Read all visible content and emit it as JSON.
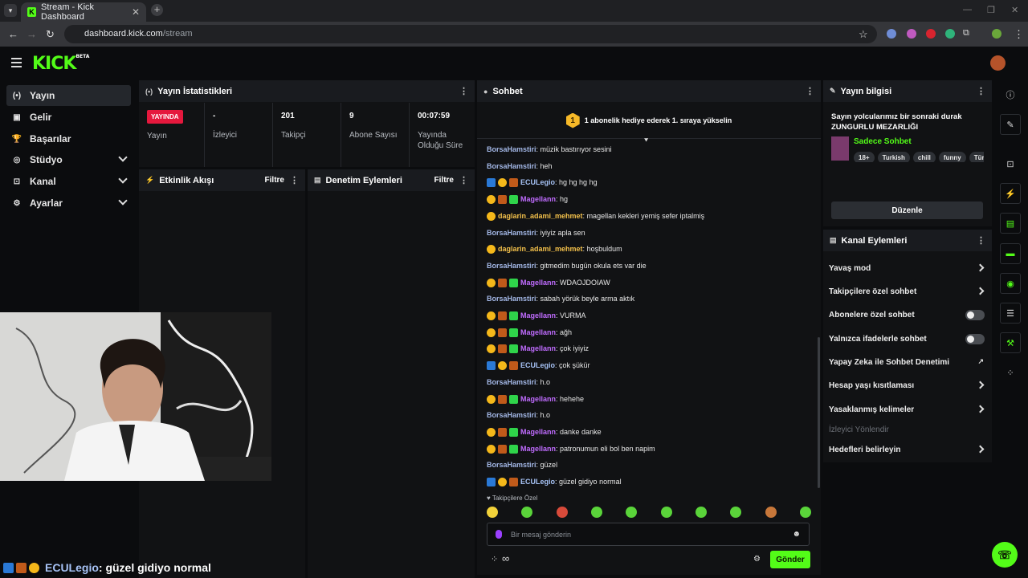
{
  "browser": {
    "tab_title": "Stream - Kick Dashboard",
    "tab_close": "✕",
    "new_tab": "+",
    "url_host": "dashboard.kick.com",
    "url_path": "/stream"
  },
  "header": {
    "logo": "KICK",
    "logo_badge": "BETA"
  },
  "sidebar": {
    "items": [
      {
        "label": "Yayın",
        "icon": "broadcast-icon",
        "glyph": "(•)"
      },
      {
        "label": "Gelir",
        "icon": "revenue-icon",
        "glyph": "▣"
      },
      {
        "label": "Başarılar",
        "icon": "trophy-icon",
        "glyph": "🏆"
      },
      {
        "label": "Stüdyo",
        "icon": "studio-icon",
        "glyph": "◎"
      },
      {
        "label": "Kanal",
        "icon": "channel-icon",
        "glyph": "⊡"
      },
      {
        "label": "Ayarlar",
        "icon": "gear-icon",
        "glyph": "⚙"
      }
    ]
  },
  "stats": {
    "title": "Yayın İstatistikleri",
    "live_badge": "YAYINDA",
    "live_label": "Yayın",
    "viewers_value": "-",
    "viewers_label": "İzleyici",
    "followers_value": "201",
    "followers_label": "Takipçi",
    "subs_value": "9",
    "subs_label": "Abone Sayısı",
    "uptime_value": "00:07:59",
    "uptime_label": "Yayında Olduğu Süre"
  },
  "activity": {
    "title": "Etkinlik Akışı",
    "filter": "Filtre"
  },
  "moderation": {
    "title": "Denetim Eylemleri",
    "filter": "Filtre"
  },
  "chat": {
    "title": "Sohbet",
    "pinned_badge": "1",
    "pinned_text": "1 abonelik hediye ederek 1. sıraya yükselin",
    "messages": [
      {
        "user": "BorsaHamstiri",
        "text": "müzik bastırıyor sesini"
      },
      {
        "user": "BorsaHamstiri",
        "text": "heh"
      },
      {
        "user": "ECULegio",
        "text": "hg hg hg hg"
      },
      {
        "user": "Magellann",
        "text": "hg"
      },
      {
        "user": "daglarin_adami_mehmet",
        "text": "magellan kekleri yemiş sefer iptalmiş"
      },
      {
        "user": "BorsaHamstiri",
        "text": "iyiyiz apla sen"
      },
      {
        "user": "daglarin_adami_mehmet",
        "text": "hoşbuldum"
      },
      {
        "user": "BorsaHamstiri",
        "text": "gitmedim bugün okula ets var die"
      },
      {
        "user": "Magellann",
        "text": "WDAOJDOIAW"
      },
      {
        "user": "BorsaHamstiri",
        "text": "sabah yörük beyle arma aktık"
      },
      {
        "user": "Magellann",
        "text": "VURMA"
      },
      {
        "user": "Magellann",
        "text": "ağh"
      },
      {
        "user": "Magellann",
        "text": "çok iyiyiz"
      },
      {
        "user": "ECULegio",
        "text": "çok şükür"
      },
      {
        "user": "BorsaHamstiri",
        "text": "h.o"
      },
      {
        "user": "Magellann",
        "text": "hehehe"
      },
      {
        "user": "BorsaHamstiri",
        "text": "h.o"
      },
      {
        "user": "Magellann",
        "text": "danke danke"
      },
      {
        "user": "Magellann",
        "text": "patronumun eli bol ben napim"
      },
      {
        "user": "BorsaHamstiri",
        "text": "güzel"
      },
      {
        "user": "ECULegio",
        "text": "güzel gidiyo normal"
      }
    ],
    "followers_only": "♥ Takipçilere Özel",
    "input_placeholder": "Bir mesaj gönderin",
    "infinity": "∞",
    "send": "Gönder"
  },
  "stream_info": {
    "title": "Yayın bilgisi",
    "stream_title": "Sayın yolcularımız bir sonraki durak ZUNGURLU MEZARLIĞI",
    "category": "Sadece Sohbet",
    "tags": [
      "18+",
      "Turkish",
      "chill",
      "funny",
      "Tür"
    ],
    "edit": "Düzenle"
  },
  "channel_actions": {
    "title": "Kanal Eylemleri",
    "items": [
      {
        "label": "Yavaş mod",
        "type": "arrow"
      },
      {
        "label": "Takipçilere özel sohbet",
        "type": "arrow"
      },
      {
        "label": "Abonelere özel sohbet",
        "type": "toggle"
      },
      {
        "label": "Yalnızca ifadelerle sohbet",
        "type": "toggle"
      },
      {
        "label": "Yapay Zeka ile Sohbet Denetimi",
        "type": "external"
      },
      {
        "label": "Hesap yaşı kısıtlaması",
        "type": "arrow"
      },
      {
        "label": "Yasaklanmış kelimeler",
        "type": "arrow"
      },
      {
        "label": "İzleyici Yönlendir",
        "type": "disabled"
      },
      {
        "label": "Hedefleri belirleyin",
        "type": "arrow"
      }
    ]
  },
  "overlay": {
    "user": "ECULegio",
    "text": ": güzel gidiyo normal"
  },
  "colors": {
    "accent": "#53fc18",
    "live": "#e5183d",
    "magellann": "#c06cff",
    "daglarin": "#f4c14b",
    "borsa": "#a3b7e6"
  }
}
